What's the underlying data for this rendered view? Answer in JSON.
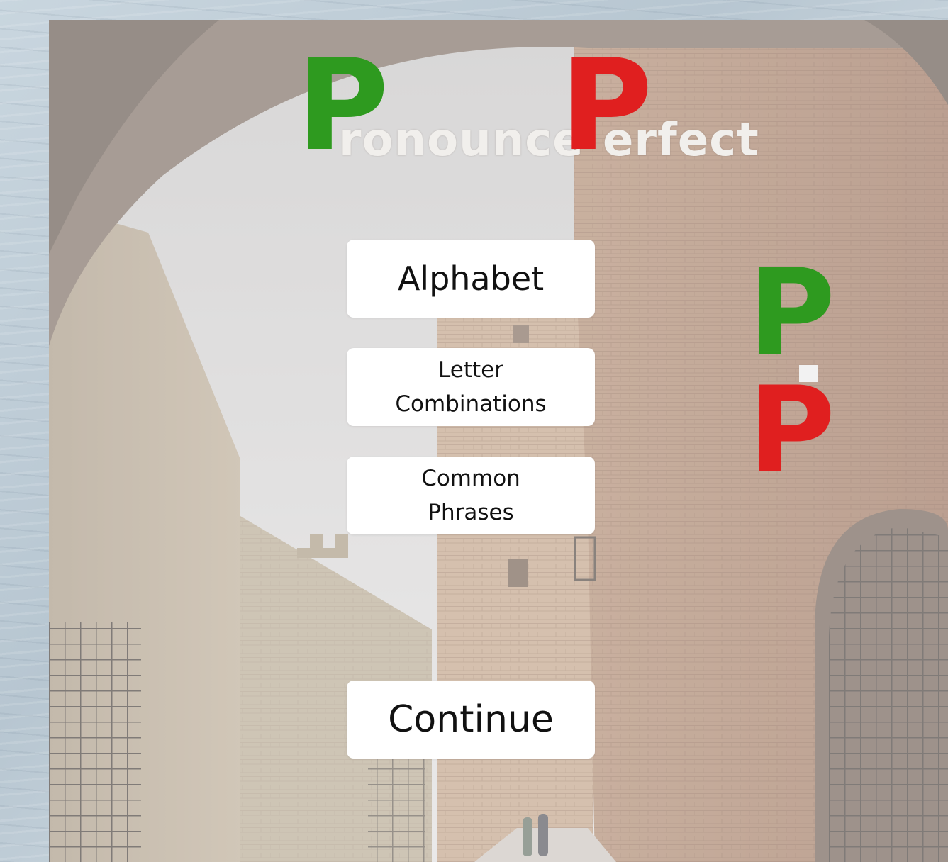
{
  "logo": {
    "word1_initial": "P",
    "word1_rest": "ronounce",
    "word2_initial": "P",
    "word2_rest": "erfect",
    "initial1_color": "#2e9a1f",
    "initial2_color": "#e01f1f"
  },
  "menu": {
    "alphabet_label": "Alphabet",
    "letter_combinations_line1": "Letter",
    "letter_combinations_line2": "Combinations",
    "common_phrases_line1": "Common",
    "common_phrases_line2": "Phrases",
    "continue_label": "Continue"
  },
  "side_badge": {
    "top_letter": "P",
    "bottom_letter": "P",
    "top_color": "#2e9a1f",
    "middle_color": "#f2f2f2",
    "bottom_color": "#e01f1f"
  }
}
